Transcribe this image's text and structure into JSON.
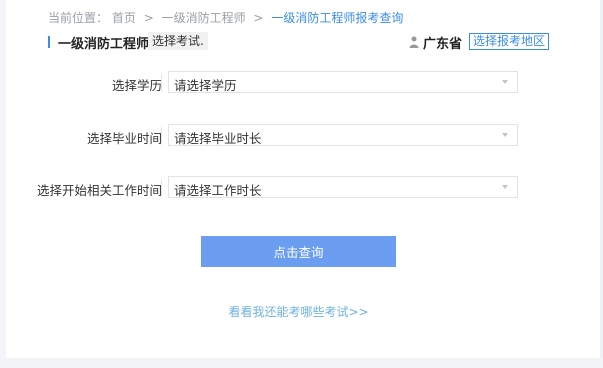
{
  "breadcrumb": {
    "prefix": "当前位置：",
    "home": "首页",
    "sep1": ">",
    "level1": "一级消防工程师",
    "sep2": ">",
    "current": "一级消防工程师报考查询"
  },
  "header": {
    "exam_title": "一级消防工程师",
    "select_exam_label": "选择考试.",
    "province": "广东省",
    "select_region_label": "选择报考地区"
  },
  "form": {
    "education": {
      "label": "选择学历",
      "value": "请选择学历"
    },
    "graduation": {
      "label": "选择毕业时间",
      "value": "请选择毕业时长"
    },
    "work": {
      "label": "选择开始相关工作时间",
      "value": "请选择工作时长"
    }
  },
  "query_button": "点击查询",
  "more_link": "看看我还能考哪些考试>>",
  "colors": {
    "accent": "#3a8ee6",
    "button": "#6b9ef0",
    "link": "#6fb3e0"
  }
}
